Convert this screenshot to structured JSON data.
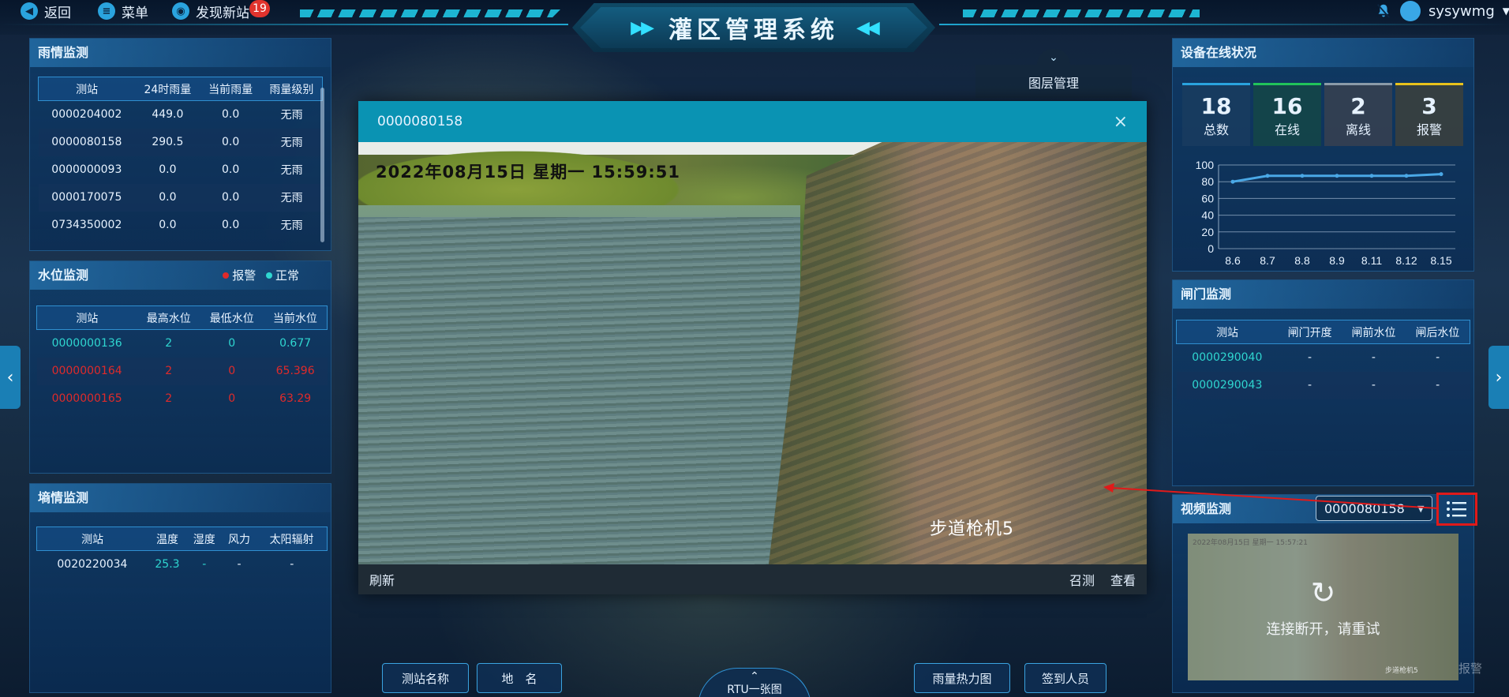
{
  "topbar": {
    "back_label": "返回",
    "menu_label": "菜单",
    "discover_label": "发现新站",
    "discover_badge": "19",
    "title": "灌区管理系统",
    "username": "sysywmg"
  },
  "rain": {
    "title": "雨情监测",
    "headers": [
      "测站",
      "24时雨量",
      "当前雨量",
      "雨量级别"
    ],
    "rows": [
      [
        "0000204002",
        "449.0",
        "0.0",
        "无雨"
      ],
      [
        "0000080158",
        "290.5",
        "0.0",
        "无雨"
      ],
      [
        "0000000093",
        "0.0",
        "0.0",
        "无雨"
      ],
      [
        "0000170075",
        "0.0",
        "0.0",
        "无雨"
      ],
      [
        "0734350002",
        "0.0",
        "0.0",
        "无雨"
      ]
    ]
  },
  "water": {
    "title": "水位监测",
    "legend_alarm": "报警",
    "legend_normal": "正常",
    "color_alarm": "#e02a2a",
    "color_normal": "#2fd6d0",
    "headers": [
      "测站",
      "最高水位",
      "最低水位",
      "当前水位"
    ],
    "rows": [
      [
        "0000000136",
        "2",
        "0",
        "0.677"
      ],
      [
        "0000000164",
        "2",
        "0",
        "65.396"
      ],
      [
        "0000000165",
        "2",
        "0",
        "63.29"
      ]
    ]
  },
  "soil": {
    "title": "墒情监测",
    "headers": [
      "测站",
      "温度",
      "湿度",
      "风力",
      "太阳辐射"
    ],
    "rows": [
      [
        "0020220034",
        "25.3",
        "-",
        "-",
        "-"
      ]
    ]
  },
  "layer": {
    "label": "图层管理"
  },
  "modal": {
    "title": "0000080158",
    "close": "×",
    "timestamp": "2022年08月15日  星期一  15:59:51",
    "camera": "步道枪机5",
    "refresh": "刷新",
    "call": "召测",
    "view": "查看"
  },
  "device": {
    "title": "设备在线状况",
    "stats": [
      {
        "value": "18",
        "label": "总数",
        "color": "#2aa3de"
      },
      {
        "value": "16",
        "label": "在线",
        "color": "#21c45a"
      },
      {
        "value": "2",
        "label": "离线",
        "color": "#8a9aa8"
      },
      {
        "value": "3",
        "label": "报警",
        "color": "#e8c21c"
      }
    ]
  },
  "chart_data": {
    "type": "line",
    "categories": [
      "8.6",
      "8.7",
      "8.8",
      "8.9",
      "8.11",
      "8.12",
      "8.15"
    ],
    "values": [
      80,
      87,
      87,
      87,
      87,
      87,
      89
    ],
    "ylim": [
      0,
      100
    ],
    "yticks": [
      0,
      20,
      40,
      60,
      80,
      100
    ],
    "grid": true,
    "line_color": "#4aa8e6"
  },
  "gate": {
    "title": "闸门监测",
    "headers": [
      "测站",
      "闸门开度",
      "闸前水位",
      "闸后水位"
    ],
    "rows": [
      [
        "0000290040",
        "-",
        "-",
        "-"
      ],
      [
        "0000290043",
        "-",
        "-",
        "-"
      ]
    ]
  },
  "video": {
    "title": "视频监测",
    "selected": "0000080158",
    "thumb_timestamp": "2022年08月15日  星期一  15:57:21",
    "thumb_camera": "步道枪机5",
    "disconnected": "连接断开，请重试",
    "partial_label": "报警"
  },
  "bottom": {
    "station_name": "测站名称",
    "place_name": "地　名",
    "rtu": "RTU一张图",
    "heatmap": "雨量热力图",
    "signin": "签到人员"
  }
}
